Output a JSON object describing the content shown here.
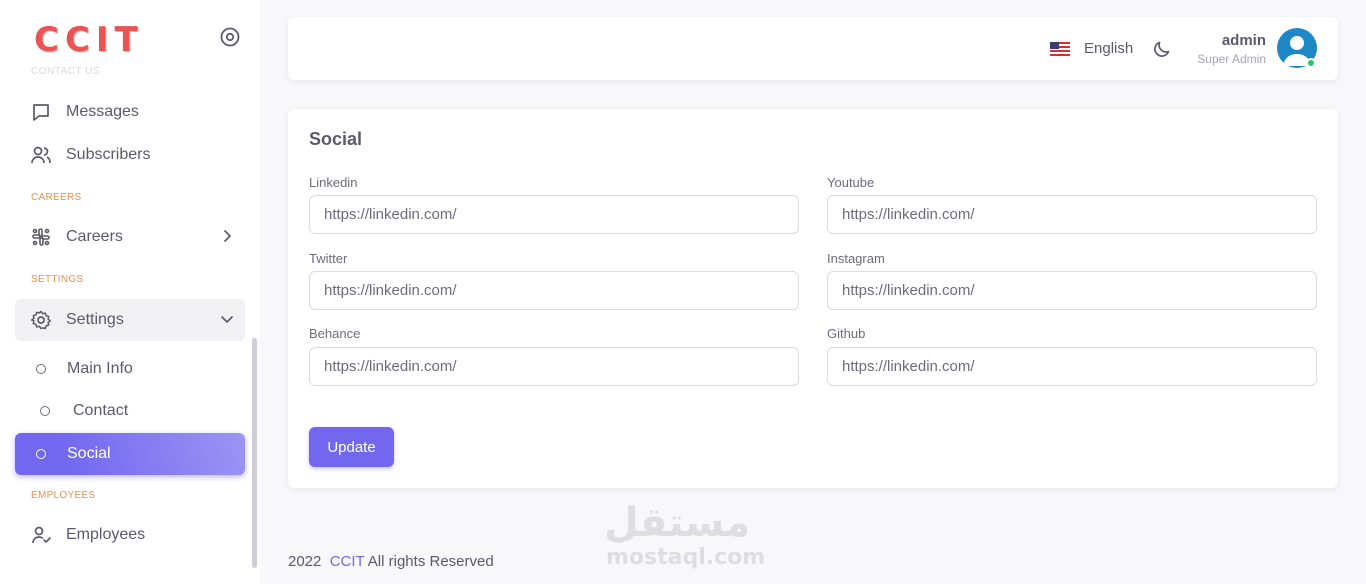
{
  "sidebar": {
    "logo": "CCIT",
    "cut_label": "CONTACT US",
    "items": {
      "messages": "Messages",
      "subscribers": "Subscribers",
      "careers": "Careers",
      "settings": "Settings",
      "employees": "Employees"
    },
    "sections": {
      "careers": "CAREERS",
      "settings": "SETTINGS",
      "employees": "EMPLOYEES"
    },
    "sub_items": {
      "main_info": "Main Info",
      "contact": "Contact",
      "social": "Social"
    },
    "active_item": "Social"
  },
  "header": {
    "language": "English",
    "user_name": "admin",
    "user_role": "Super Admin"
  },
  "card": {
    "title": "Social",
    "fields": {
      "linkedin": {
        "label": "Linkedin",
        "value": "https://linkedin.com/"
      },
      "youtube": {
        "label": "Youtube",
        "value": "https://linkedin.com/"
      },
      "twitter": {
        "label": "Twitter",
        "value": "https://linkedin.com/"
      },
      "instagram": {
        "label": "Instagram",
        "value": "https://linkedin.com/"
      },
      "behance": {
        "label": "Behance",
        "value": "https://linkedin.com/"
      },
      "github": {
        "label": "Github",
        "value": "https://linkedin.com/"
      }
    },
    "update_label": "Update"
  },
  "footer": {
    "year": "2022",
    "brand": "CCIT",
    "rights": "All rights Reserved"
  },
  "watermark": {
    "arabic": "مستقل",
    "latin": "mostaql.com"
  },
  "colors": {
    "primary": "#7367f0",
    "section_label": "#e8914d",
    "logo": "#ea5455",
    "online": "#28c76f"
  }
}
